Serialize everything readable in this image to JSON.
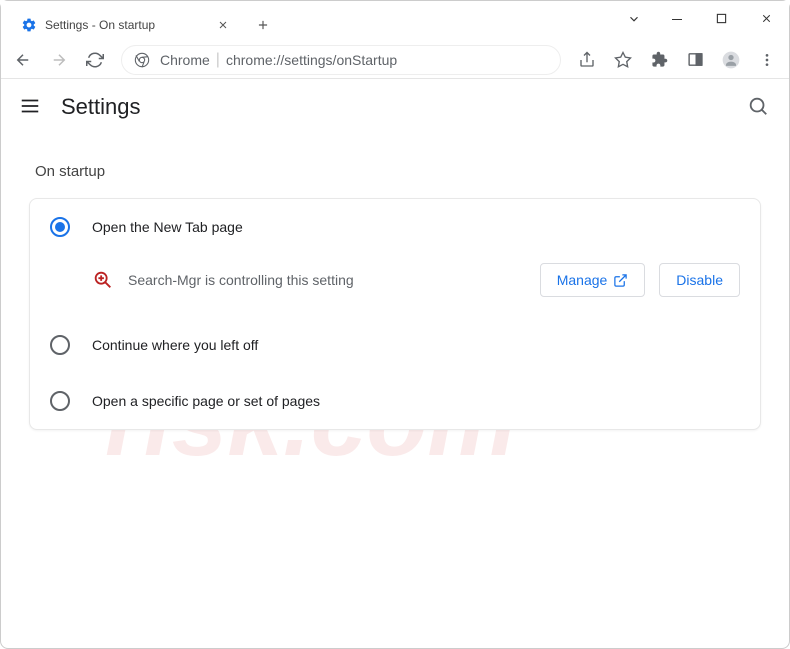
{
  "tab": {
    "title": "Settings - On startup"
  },
  "omnibox": {
    "label": "Chrome",
    "url": "chrome://settings/onStartup"
  },
  "app": {
    "title": "Settings"
  },
  "section": {
    "title": "On startup"
  },
  "startup": {
    "options": [
      {
        "label": "Open the New Tab page",
        "selected": true
      },
      {
        "label": "Continue where you left off",
        "selected": false
      },
      {
        "label": "Open a specific page or set of pages",
        "selected": false
      }
    ],
    "notice": {
      "text": "Search-Mgr is controlling this setting",
      "manage_label": "Manage",
      "disable_label": "Disable"
    }
  }
}
